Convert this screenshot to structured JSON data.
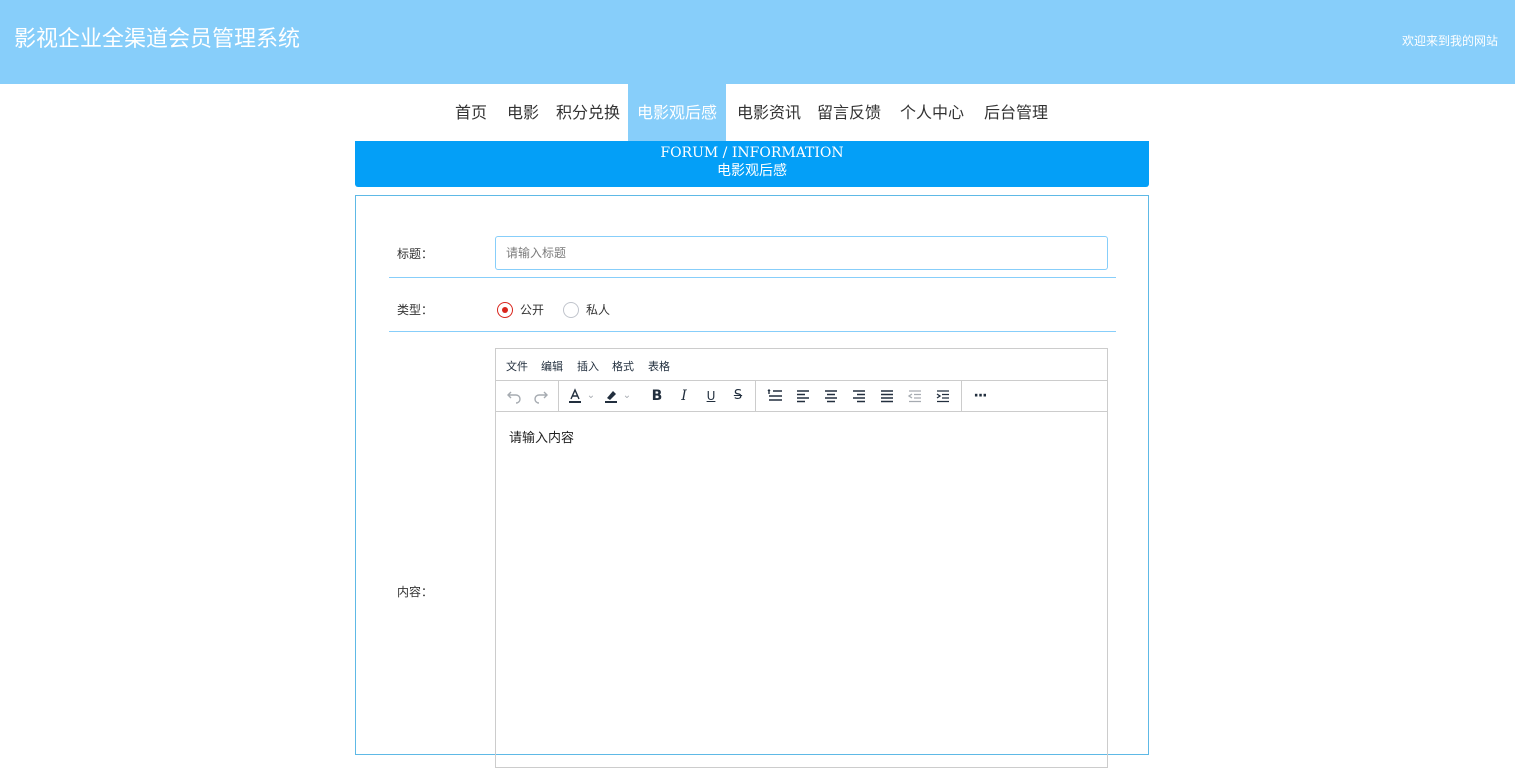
{
  "header": {
    "site_title": "影视企业全渠道会员管理系统",
    "welcome": "欢迎来到我的网站",
    "bg_color": "#87cefa"
  },
  "nav": {
    "items": [
      {
        "label": "首页",
        "active": false
      },
      {
        "label": "电影",
        "active": false
      },
      {
        "label": "积分兑换",
        "active": false
      },
      {
        "label": "电影观后感",
        "active": true
      },
      {
        "label": "电影资讯",
        "active": false
      },
      {
        "label": "留言反馈",
        "active": false
      },
      {
        "label": "个人中心",
        "active": false
      },
      {
        "label": "后台管理",
        "active": false
      }
    ]
  },
  "banner": {
    "en": "FORUM / INFORMATION",
    "cn": "电影观后感",
    "color": "#049ff7"
  },
  "form": {
    "title_label": "标题：",
    "title_placeholder": "请输入标题",
    "type_label": "类型：",
    "type_options": [
      {
        "label": "公开",
        "checked": true
      },
      {
        "label": "私人",
        "checked": false
      }
    ],
    "content_label": "内容：",
    "content_placeholder": "请输入内容"
  },
  "editor": {
    "menus": [
      "文件",
      "编辑",
      "插入",
      "格式",
      "表格"
    ],
    "toolbar_icons": [
      "undo-icon",
      "redo-icon",
      "text-color-icon",
      "highlight-color-icon",
      "bold-icon",
      "italic-icon",
      "underline-icon",
      "strikethrough-icon",
      "line-height-icon",
      "align-left-icon",
      "align-center-icon",
      "align-right-icon",
      "align-justify-icon",
      "outdent-icon",
      "indent-icon",
      "more-icon"
    ]
  }
}
